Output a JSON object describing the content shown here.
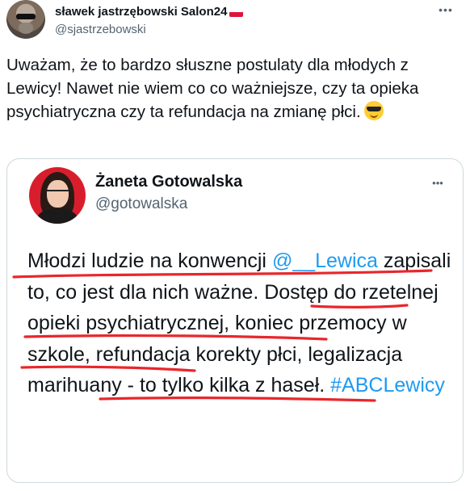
{
  "tweet": {
    "author": {
      "display_name": "sławek jastrzębowski Salon24",
      "handle": "@sjastrzebowski",
      "flag_icon": "poland-flag-icon"
    },
    "text": "Uważam, że to bardzo słuszne postulaty dla młodych z Lewicy! Nawet nie wiem co co ważniejsze, czy ta opieka psychiatryczna czy ta refundacja na zmianę płci.",
    "emoji_icon": "smiling-face-with-sunglasses-icon",
    "more_icon": "more-horizontal-icon"
  },
  "quoted_tweet": {
    "author": {
      "display_name": "Żaneta Gotowalska",
      "handle": "@gotowalska"
    },
    "segments": {
      "s1": "Młodzi ludzie na konwencji ",
      "mention": "@__Lewica",
      "s2": " zapisali to, co jest dla nich ważne. Dostęp do rzetelnej opieki psychiatrycznej, koniec przemocy w szkole, refundacja korekty płci, legalizacja marihuany - to tylko kilka z haseł. ",
      "hashtag": "#ABCLewicy"
    },
    "annotation_color": "#e8272b",
    "link_color": "#1d9bf0"
  }
}
